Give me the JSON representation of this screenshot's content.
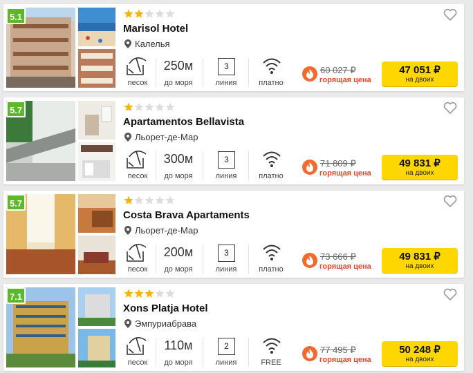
{
  "colors": {
    "accent": "#ffd700",
    "rating": "#5cb82a",
    "hot": "#e8462b",
    "star_on": "#f5b400",
    "star_off": "#dcdcdc"
  },
  "hotels": [
    {
      "rating": "5.1",
      "stars_filled": 2,
      "stars_total": 5,
      "name": "Marisol Hotel",
      "location": "Калелья",
      "beach_caption": "песок",
      "distance": "250м",
      "distance_caption": "до моря",
      "line": "3",
      "line_caption": "линия",
      "wifi_caption": "платно",
      "old_price": "60 027 ₽",
      "hot_label": "горящая цена",
      "price": "47 051 ₽",
      "price_sub": "на двоих"
    },
    {
      "rating": "5.7",
      "stars_filled": 1,
      "stars_total": 5,
      "name": "Apartamentos Bellavista",
      "location": "Льорет-де-Мар",
      "beach_caption": "песок",
      "distance": "300м",
      "distance_caption": "до моря",
      "line": "3",
      "line_caption": "линия",
      "wifi_caption": "платно",
      "old_price": "71 809 ₽",
      "hot_label": "горящая цена",
      "price": "49 831 ₽",
      "price_sub": "на двоих"
    },
    {
      "rating": "5.7",
      "stars_filled": 1,
      "stars_total": 5,
      "name": "Costa Brava Apartaments",
      "location": "Льорет-де-Мар",
      "beach_caption": "песок",
      "distance": "200м",
      "distance_caption": "до моря",
      "line": "3",
      "line_caption": "линия",
      "wifi_caption": "платно",
      "old_price": "73 666 ₽",
      "hot_label": "горящая цена",
      "price": "49 831 ₽",
      "price_sub": "на двоих"
    },
    {
      "rating": "7.1",
      "stars_filled": 3,
      "stars_total": 5,
      "name": "Xons Platja Hotel",
      "location": "Эмпуриабрава",
      "beach_caption": "песок",
      "distance": "110м",
      "distance_caption": "до моря",
      "line": "2",
      "line_caption": "линия",
      "wifi_caption": "FREE",
      "old_price": "77 495 ₽",
      "hot_label": "горящая цена",
      "price": "50 248 ₽",
      "price_sub": "на двоих"
    }
  ],
  "icons": {
    "beach": "beach-umbrella-icon",
    "wifi": "wifi-icon",
    "fire": "fire-icon",
    "pin": "location-pin-icon",
    "heart": "heart-icon",
    "star": "star-icon"
  }
}
